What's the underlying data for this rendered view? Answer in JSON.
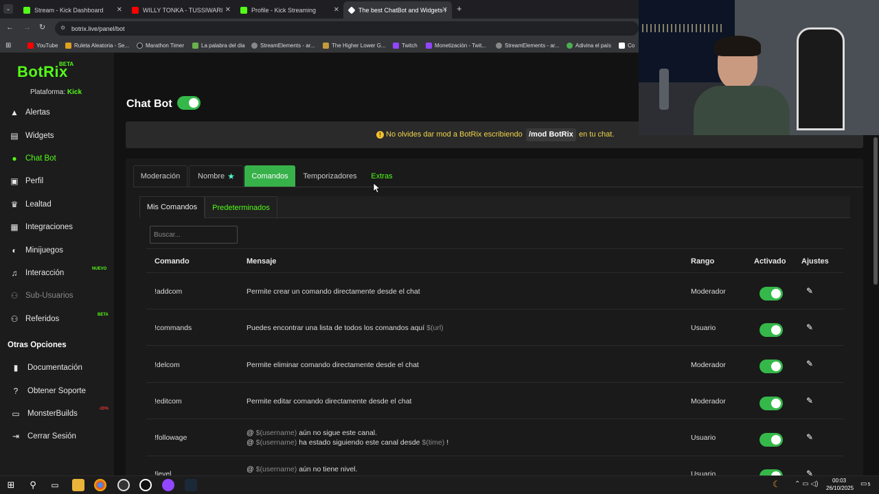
{
  "browser": {
    "tabs": [
      {
        "title": "Stream - Kick Dashboard",
        "color": "#53fc18"
      },
      {
        "title": "WILLY TONKA - TUSSIWARI",
        "color": "#ff0000"
      },
      {
        "title": "Profile - Kick Streaming",
        "color": "#53fc18"
      },
      {
        "title": "The best ChatBot and Widgets f",
        "color": "#ffffff"
      }
    ],
    "url": "botrix.live/panel/bot",
    "bookmarks": [
      "YouTube",
      "Ruleta Aleatoria - Se...",
      "Marathon Timer",
      "La palabra del dia",
      "StreamElements - ar...",
      "The Higher Lower G...",
      "Twitch",
      "Monetización - Twit...",
      "StreamElements - ar...",
      "Adivina el país",
      "Co"
    ]
  },
  "brand": {
    "name": "BotRix",
    "beta": "BETA",
    "platform_label": "Plataforma:",
    "platform": "Kick",
    "accent": "#53fc18"
  },
  "sidebar": {
    "items": [
      {
        "label": "Alertas",
        "icon": "warning-icon"
      },
      {
        "label": "Widgets",
        "icon": "window-icon"
      },
      {
        "label": "Chat Bot",
        "icon": "robot-icon"
      },
      {
        "label": "Perfil",
        "icon": "id-card-icon"
      },
      {
        "label": "Lealtad",
        "icon": "trophy-icon"
      },
      {
        "label": "Integraciones",
        "icon": "server-icon"
      },
      {
        "label": "Minijuegos",
        "icon": "gamepad-icon"
      },
      {
        "label": "Interacción",
        "icon": "music-icon",
        "tag": "NUEVO"
      },
      {
        "label": "Sub-Usuarios",
        "icon": "users-icon"
      },
      {
        "label": "Referidos",
        "icon": "users-icon",
        "tag": "BETA"
      }
    ],
    "section_title": "Otras Opciones",
    "other": [
      {
        "label": "Documentación",
        "icon": "book-icon"
      },
      {
        "label": "Obtener Soporte",
        "icon": "help-icon"
      },
      {
        "label": "MonsterBuilds",
        "icon": "laptop-icon",
        "tag": "-20%"
      },
      {
        "label": "Cerrar Sesión",
        "icon": "logout-icon"
      }
    ]
  },
  "main": {
    "title": "Chat Bot",
    "enabled": true,
    "notice": {
      "text": "No olvides dar mod a BotRix escribiendo",
      "command": "/mod BotRix",
      "tail": "en tu chat."
    },
    "tabs": [
      "Moderación",
      "Nombre",
      "Comandos",
      "Temporizadores",
      "Extras"
    ],
    "active_tab": "Comandos",
    "subtabs": [
      "Mis Comandos",
      "Predeterminados"
    ],
    "search_placeholder": "Buscar...",
    "columns": [
      "Comando",
      "Mensaje",
      "Rango",
      "Activado",
      "Ajustes"
    ],
    "rows": [
      {
        "command": "!addcom",
        "message": "Permite crear un comando directamente desde el chat",
        "rank": "Moderador",
        "enabled": true
      },
      {
        "command": "!commands",
        "message": "Puedes encontrar una lista de todos los comandos aquí",
        "var": "$(url)",
        "rank": "Usuario",
        "enabled": true
      },
      {
        "command": "!delcom",
        "message": "Permite eliminar comando directamente desde el chat",
        "rank": "Moderador",
        "enabled": true
      },
      {
        "command": "!editcom",
        "message": "Permite editar comando directamente desde el chat",
        "rank": "Moderador",
        "enabled": true
      },
      {
        "command": "!followage",
        "line1_var": "$(username)",
        "line1": "aún no sigue este canal.",
        "line2_var": "$(username)",
        "line2": "ha estado siguiendo este canal desde",
        "line2_var2": "$(time)",
        "line2_end": "!",
        "rank": "Usuario",
        "enabled": true
      },
      {
        "command": "!level",
        "line1_var": "$(username)",
        "line1": "aún no tiene nivel.",
        "rank": "Usuario",
        "enabled": true
      }
    ]
  },
  "taskbar": {
    "time": "00:03",
    "date": "26/10/2025",
    "notifications": "5"
  }
}
